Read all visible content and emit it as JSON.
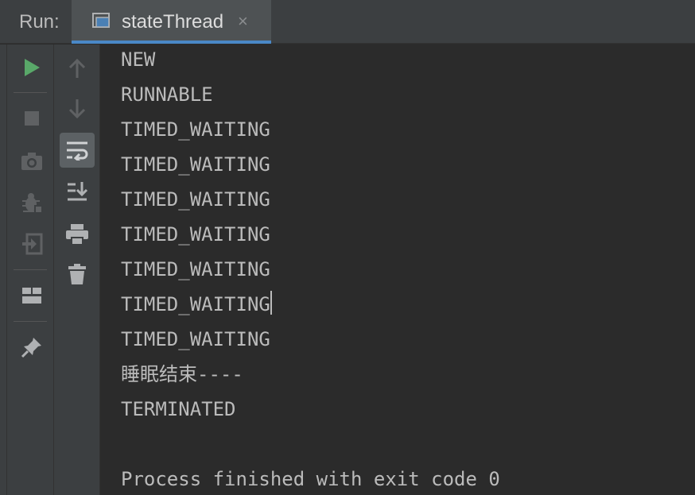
{
  "header": {
    "run_label": "Run:",
    "tab": {
      "title": "stateThread",
      "close_glyph": "×",
      "icon": "console-window-icon"
    },
    "accent_color": "#4a88c7"
  },
  "left_toolbar": {
    "items": [
      {
        "name": "rerun",
        "icon": "play-icon",
        "color": "#59a869"
      },
      {
        "name": "stop",
        "icon": "stop-icon"
      },
      {
        "name": "dump-threads",
        "icon": "camera-icon"
      },
      {
        "name": "debug",
        "icon": "bug-icon"
      },
      {
        "name": "exit",
        "icon": "exit-icon"
      },
      {
        "name": "layout",
        "icon": "layout-icon"
      },
      {
        "name": "pin-tab",
        "icon": "pin-icon"
      }
    ]
  },
  "console_toolbar": {
    "items": [
      {
        "name": "up-stack-trace",
        "icon": "arrow-up-icon"
      },
      {
        "name": "down-stack-trace",
        "icon": "arrow-down-icon"
      },
      {
        "name": "soft-wrap",
        "icon": "soft-wrap-icon",
        "active": true
      },
      {
        "name": "scroll-to-end",
        "icon": "scroll-to-end-icon"
      },
      {
        "name": "print",
        "icon": "printer-icon"
      },
      {
        "name": "clear-all",
        "icon": "trash-icon"
      }
    ]
  },
  "console": {
    "lines": [
      "NEW",
      "RUNNABLE",
      "TIMED_WAITING",
      "TIMED_WAITING",
      "TIMED_WAITING",
      "TIMED_WAITING",
      "TIMED_WAITING",
      "TIMED_WAITING",
      "TIMED_WAITING",
      "睡眠结束----",
      "TERMINATED",
      "",
      "Process finished with exit code 0"
    ]
  }
}
